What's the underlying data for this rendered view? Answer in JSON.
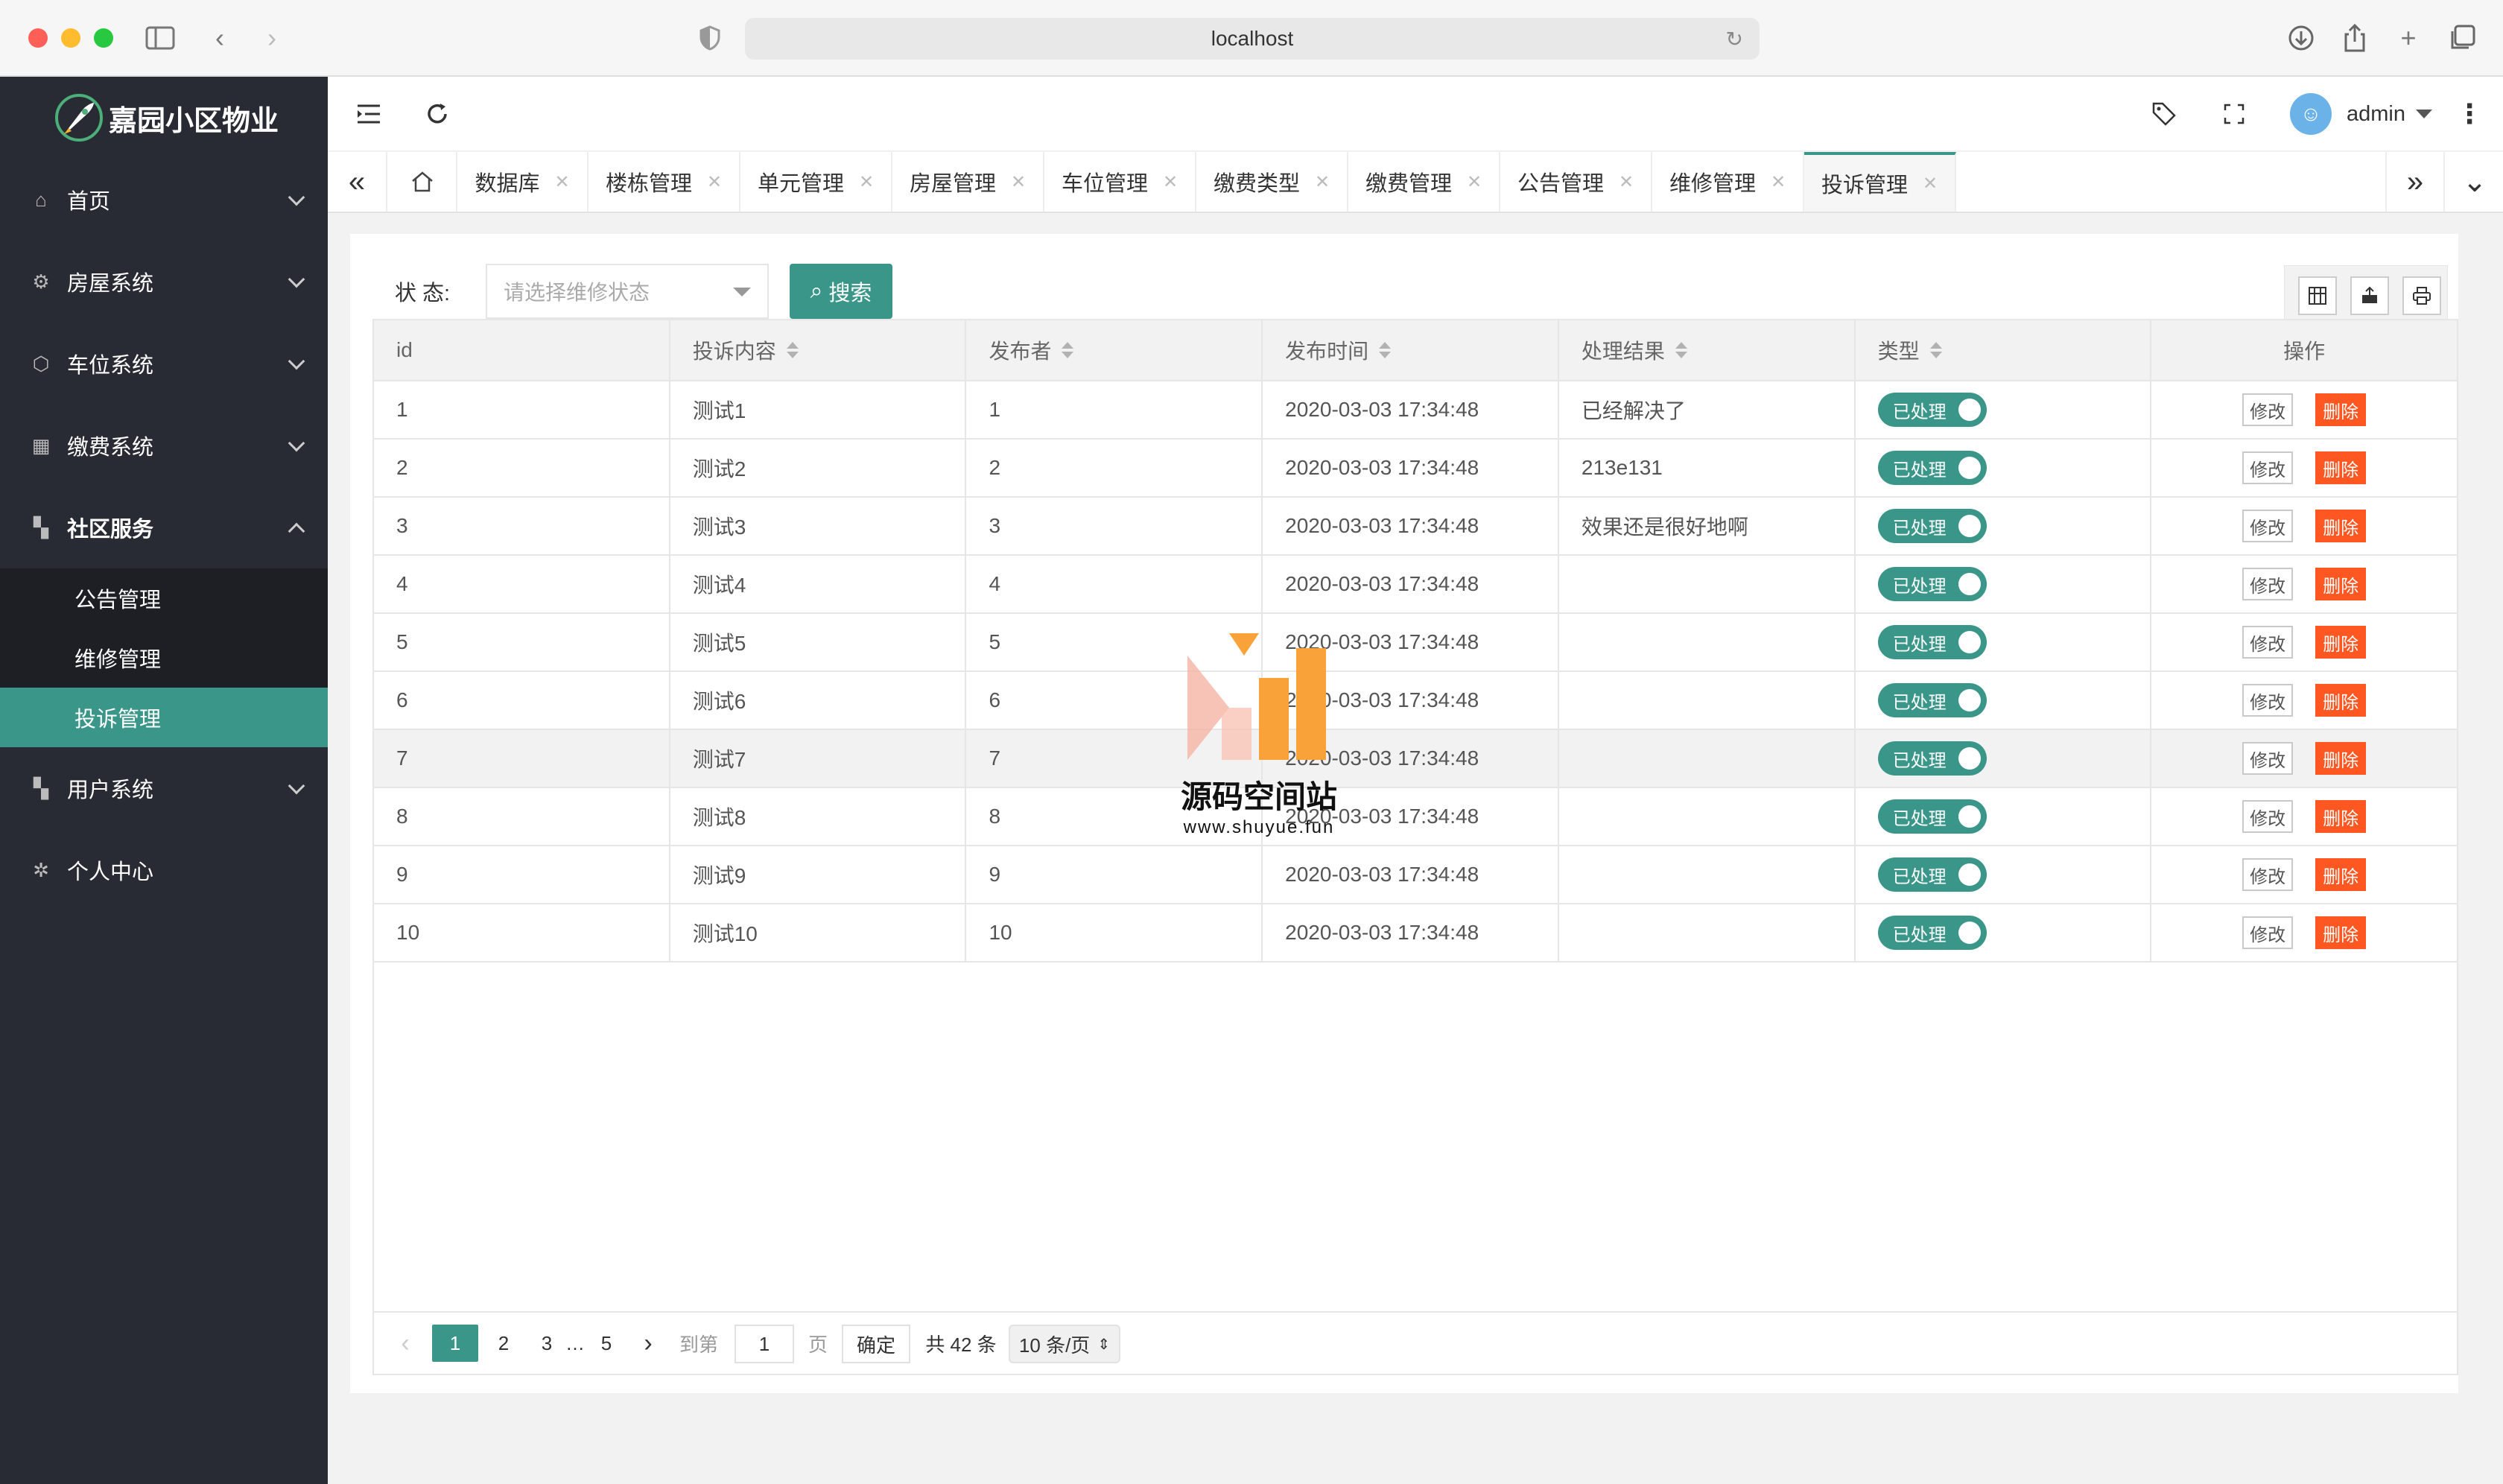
{
  "browser": {
    "url": "localhost"
  },
  "sidebar": {
    "app_name": "嘉园小区物业",
    "items": [
      {
        "label": "首页"
      },
      {
        "label": "房屋系统"
      },
      {
        "label": "车位系统"
      },
      {
        "label": "缴费系统"
      },
      {
        "label": "社区服务"
      },
      {
        "label": "用户系统"
      },
      {
        "label": "个人中心"
      }
    ],
    "submenu": [
      {
        "label": "公告管理"
      },
      {
        "label": "维修管理"
      },
      {
        "label": "投诉管理"
      }
    ]
  },
  "header": {
    "user": "admin"
  },
  "tabs": [
    {
      "label": "数据库"
    },
    {
      "label": "楼栋管理"
    },
    {
      "label": "单元管理"
    },
    {
      "label": "房屋管理"
    },
    {
      "label": "车位管理"
    },
    {
      "label": "缴费类型"
    },
    {
      "label": "缴费管理"
    },
    {
      "label": "公告管理"
    },
    {
      "label": "维修管理"
    },
    {
      "label": "投诉管理"
    }
  ],
  "filter": {
    "label": "状 态:",
    "placeholder": "请选择维修状态",
    "search_label": "搜索"
  },
  "table": {
    "columns": [
      "id",
      "投诉内容",
      "发布者",
      "发布时间",
      "处理结果",
      "类型",
      "操作"
    ],
    "rows": [
      [
        "1",
        "测试1",
        "1",
        "2020-03-03 17:34:48",
        "已经解决了"
      ],
      [
        "2",
        "测试2",
        "2",
        "2020-03-03 17:34:48",
        "213e131"
      ],
      [
        "3",
        "测试3",
        "3",
        "2020-03-03 17:34:48",
        "效果还是很好地啊"
      ],
      [
        "4",
        "测试4",
        "4",
        "2020-03-03 17:34:48",
        ""
      ],
      [
        "5",
        "测试5",
        "5",
        "2020-03-03 17:34:48",
        ""
      ],
      [
        "6",
        "测试6",
        "6",
        "2020-03-03 17:34:48",
        ""
      ],
      [
        "7",
        "测试7",
        "7",
        "2020-03-03 17:34:48",
        ""
      ],
      [
        "8",
        "测试8",
        "8",
        "2020-03-03 17:34:48",
        ""
      ],
      [
        "9",
        "测试9",
        "9",
        "2020-03-03 17:34:48",
        ""
      ],
      [
        "10",
        "测试10",
        "10",
        "2020-03-03 17:34:48",
        ""
      ]
    ],
    "status_label": "已处理",
    "edit_label": "修改",
    "delete_label": "删除"
  },
  "pagination": {
    "pages": [
      "1",
      "2",
      "3",
      "…",
      "5"
    ],
    "goto_label": "到第",
    "goto_value": "1",
    "page_unit": "页",
    "confirm": "确定",
    "total": "共 42 条",
    "page_size": "10 条/页"
  },
  "watermark": {
    "title": "源码空间站",
    "url": "www.shuyue.fun"
  }
}
